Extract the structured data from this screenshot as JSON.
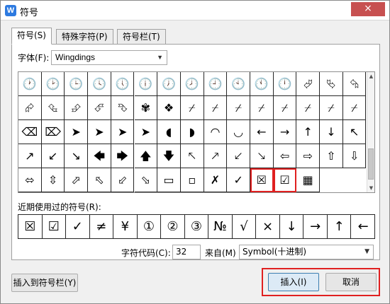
{
  "window": {
    "app_icon": "W",
    "title": "符号",
    "close_label": "×"
  },
  "tabs": [
    {
      "label": "符号(S)",
      "active": true
    },
    {
      "label": "特殊字符(P)",
      "active": false
    },
    {
      "label": "符号栏(T)",
      "active": false
    }
  ],
  "font": {
    "label": "字体(F):",
    "value": "Wingdings"
  },
  "symbol_grid": {
    "columns": 15,
    "cells": [
      "🕐",
      "🕑",
      "🕒",
      "🕓",
      "🕔",
      "🕕",
      "🕖",
      "🕗",
      "🕘",
      "🕙",
      "🕚",
      "🕛",
      "⮰",
      "⮱",
      "⮲",
      "⮳",
      "⮴",
      "⮵",
      "⮶",
      "⮷",
      "✾",
      "❖",
      "⌿",
      "⌿",
      "⌿",
      "⌿",
      "⌿",
      "⌿",
      "⌿",
      "⌿",
      "⌫",
      "⌦",
      "➤",
      "➤",
      "➤",
      "➤",
      "◖",
      "◗",
      "◠",
      "◡",
      "←",
      "→",
      "↑",
      "↓",
      "↖",
      "↗",
      "↙",
      "↘",
      "🡄",
      "🡆",
      "🡅",
      "🡇",
      "🡔",
      "🡕",
      "🡗",
      "🡖",
      "⇦",
      "⇨",
      "⇧",
      "⇩",
      "⬄",
      "⇳",
      "⬀",
      "⬁",
      "⬃",
      "⬂",
      "▭",
      "▫",
      "✗",
      "✓",
      "☒",
      "☑",
      "▦"
    ],
    "selected": [
      70,
      71
    ]
  },
  "recent": {
    "label": "近期使用过的符号(R):",
    "items": [
      "☒",
      "☑",
      "✓",
      "≠",
      "¥",
      "①",
      "②",
      "③",
      "№",
      "√",
      "×",
      "↓",
      "→",
      "↑",
      "←"
    ]
  },
  "char_code": {
    "label": "字符代码(C):",
    "value": "32"
  },
  "from": {
    "label": "来自(M)",
    "value": "Symbol(十进制)"
  },
  "buttons": {
    "add_to_bar": "插入到符号栏(Y)",
    "insert": "插入(I)",
    "cancel": "取消"
  },
  "colors": {
    "highlight": "#e02020",
    "accent": "#2d7ae0"
  }
}
